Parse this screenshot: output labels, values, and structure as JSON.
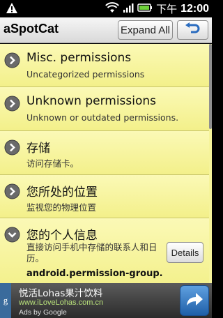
{
  "status_bar": {
    "ampm": "下午",
    "time": "12:00",
    "icons": [
      "warning-icon",
      "wifi-icon",
      "signal-icon",
      "battery-icon"
    ]
  },
  "app": {
    "title": "aSpotCat",
    "expand_all_label": "Expand All",
    "back_icon": "back-arrow-icon"
  },
  "permissions": [
    {
      "title": "Misc. permissions",
      "subtitle": "Uncategorized permissions",
      "expanded": false
    },
    {
      "title": "Unknown permissions",
      "subtitle": "Unknown or outdated permissions.",
      "expanded": false
    },
    {
      "title": "存储",
      "subtitle": "访问存储卡。",
      "expanded": false
    },
    {
      "title": "您所处的位置",
      "subtitle": "监视您的物理位置",
      "expanded": false
    },
    {
      "title": "您的个人信息",
      "subtitle": "直接访问手机中存储的联系人和日历。",
      "expanded": true,
      "details_label": "Details",
      "permission_name": "android.permission-group."
    }
  ],
  "ad": {
    "title": "悦活Lohas果汁饮料",
    "url": "www.iLoveLohas.com.cn",
    "attribution": "Ads by Google",
    "brand_letter": "g"
  },
  "colors": {
    "row_bg": "#f6f49b",
    "accent_blue": "#2a6cbf",
    "ad_url": "#b9e27a"
  }
}
